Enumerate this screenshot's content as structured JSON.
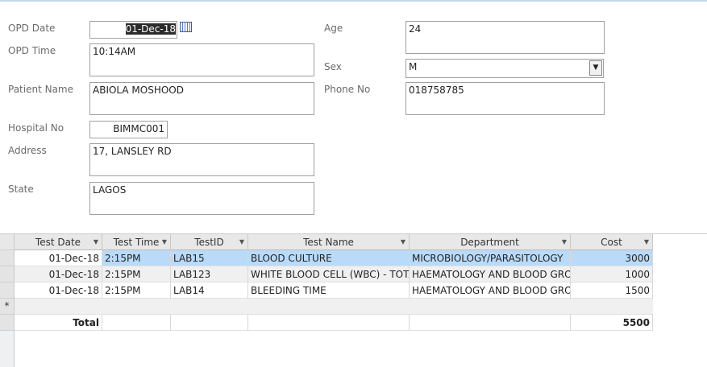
{
  "form": {
    "opd_date": {
      "label": "OPD Date",
      "value": "01-Dec-18"
    },
    "opd_time": {
      "label": "OPD Time",
      "value": "10:14AM"
    },
    "patient_name": {
      "label": "Patient Name",
      "value": "ABIOLA MOSHOOD"
    },
    "hospital_no": {
      "label": "Hospital No",
      "value": "BIMMC001"
    },
    "address": {
      "label": "Address",
      "value": "17, LANSLEY RD"
    },
    "state": {
      "label": "State",
      "value": "LAGOS"
    },
    "age": {
      "label": "Age",
      "value": "24"
    },
    "sex": {
      "label": "Sex",
      "value": "M"
    },
    "phone_no": {
      "label": "Phone No",
      "value": "018758785"
    }
  },
  "grid": {
    "columns": [
      "Test Date",
      "Test Time",
      "TestID",
      "Test Name",
      "Department",
      "Cost"
    ],
    "rows": [
      [
        "01-Dec-18",
        "2:15PM",
        "LAB15",
        "BLOOD CULTURE",
        "MICROBIOLOGY/PARASITOLOGY",
        "3000"
      ],
      [
        "01-Dec-18",
        "2:15PM",
        "LAB123",
        "WHITE BLOOD CELL  (WBC) - TOTAL",
        "HAEMATOLOGY AND BLOOD GROUP",
        "1000"
      ],
      [
        "01-Dec-18",
        "2:15PM",
        "LAB14",
        "BLEEDING TIME",
        "HAEMATOLOGY AND BLOOD GROUP",
        "1500"
      ]
    ],
    "new_row_marker": "*",
    "total_label": "Total",
    "total_value": "5500"
  }
}
